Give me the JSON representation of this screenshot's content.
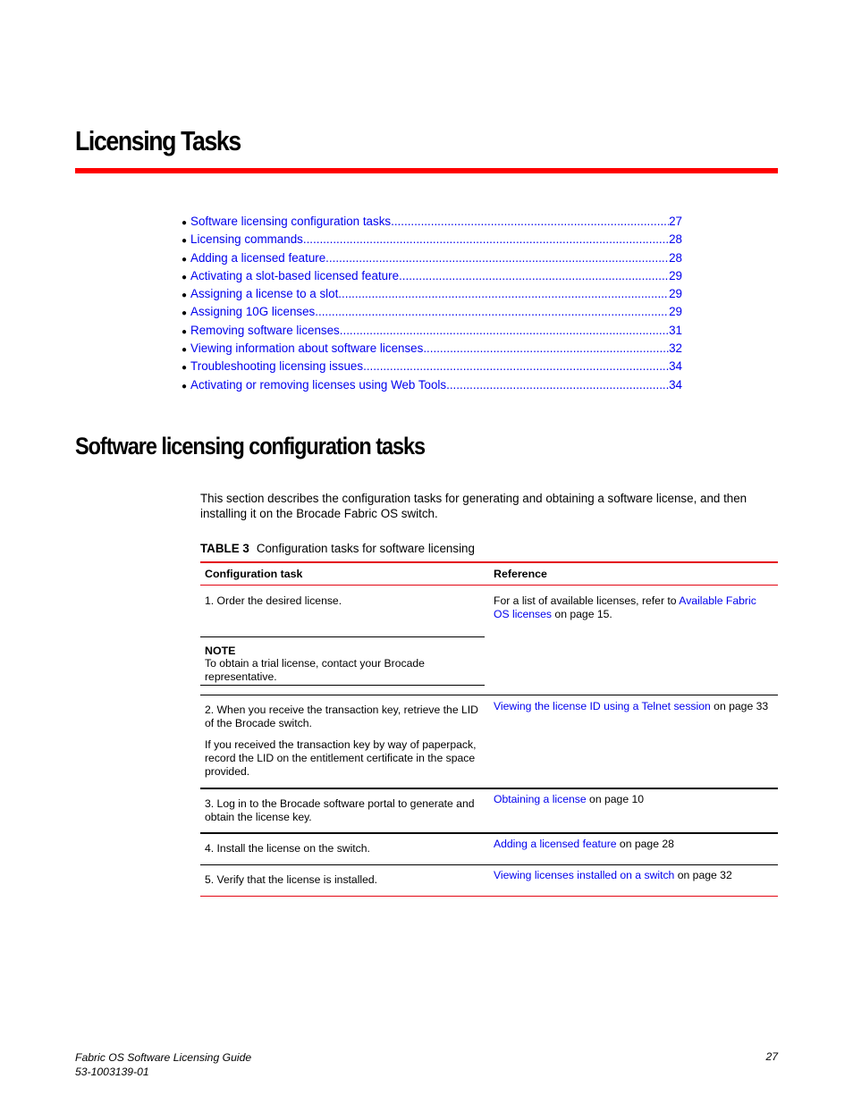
{
  "chapter": {
    "title": "Licensing Tasks",
    "accent_color": "#ff0000"
  },
  "toc": {
    "bullet_glyph": "●",
    "items": [
      {
        "label": "Software licensing configuration tasks",
        "page": "27"
      },
      {
        "label": "Licensing commands",
        "page": "28"
      },
      {
        "label": "Adding a licensed feature",
        "page": "28"
      },
      {
        "label": "Activating a slot-based licensed feature",
        "page": "29"
      },
      {
        "label": "Assigning a license to a slot",
        "page": "29"
      },
      {
        "label": "Assigning 10G licenses",
        "page": "29"
      },
      {
        "label": "Removing software licenses",
        "page": "31"
      },
      {
        "label": "Viewing information about software licenses",
        "page": "32"
      },
      {
        "label": "Troubleshooting licensing issues",
        "page": "34"
      },
      {
        "label": "Activating or removing licenses using Web Tools",
        "page": "34"
      }
    ],
    "link_color": "#0000ee"
  },
  "section": {
    "title": "Software licensing configuration tasks",
    "intro": "This section describes the configuration tasks for generating and obtaining a software license, and then installing it on the Brocade Fabric OS switch."
  },
  "table": {
    "caption_label": "TABLE 3",
    "caption_text": "Configuration tasks for software licensing",
    "headers": [
      "Configuration task",
      "Reference"
    ],
    "rows": [
      {
        "task": "1. Order the desired license.",
        "note_label": "NOTE",
        "note_text": "To obtain a trial license, contact your Brocade representative.",
        "ref_prefix": "For a list of available licenses, refer to ",
        "ref_link": "Available Fabric OS licenses",
        "ref_suffix": " on page 15."
      },
      {
        "task": "2. When you receive the transaction key, retrieve the LID of the Brocade switch.",
        "task_extra": "If you received the transaction key by way of paperpack, record the LID on the entitlement certificate in the space provided.",
        "ref_link": "Viewing the license ID using a Telnet session",
        "ref_suffix": " on page 33"
      },
      {
        "task": "3. Log in to the Brocade software portal to generate and obtain the license key.",
        "ref_link": "Obtaining a license",
        "ref_suffix": " on page 10"
      },
      {
        "task": "4. Install the license on the switch.",
        "ref_link": "Adding a licensed feature",
        "ref_suffix": " on page 28"
      },
      {
        "task": "5. Verify that the license is installed.",
        "ref_link": "Viewing licenses installed on a switch",
        "ref_suffix": " on page 32"
      }
    ]
  },
  "footer": {
    "doc_title": "Fabric OS Software Licensing Guide",
    "doc_number": "53-1003139-01",
    "page_number": "27"
  }
}
